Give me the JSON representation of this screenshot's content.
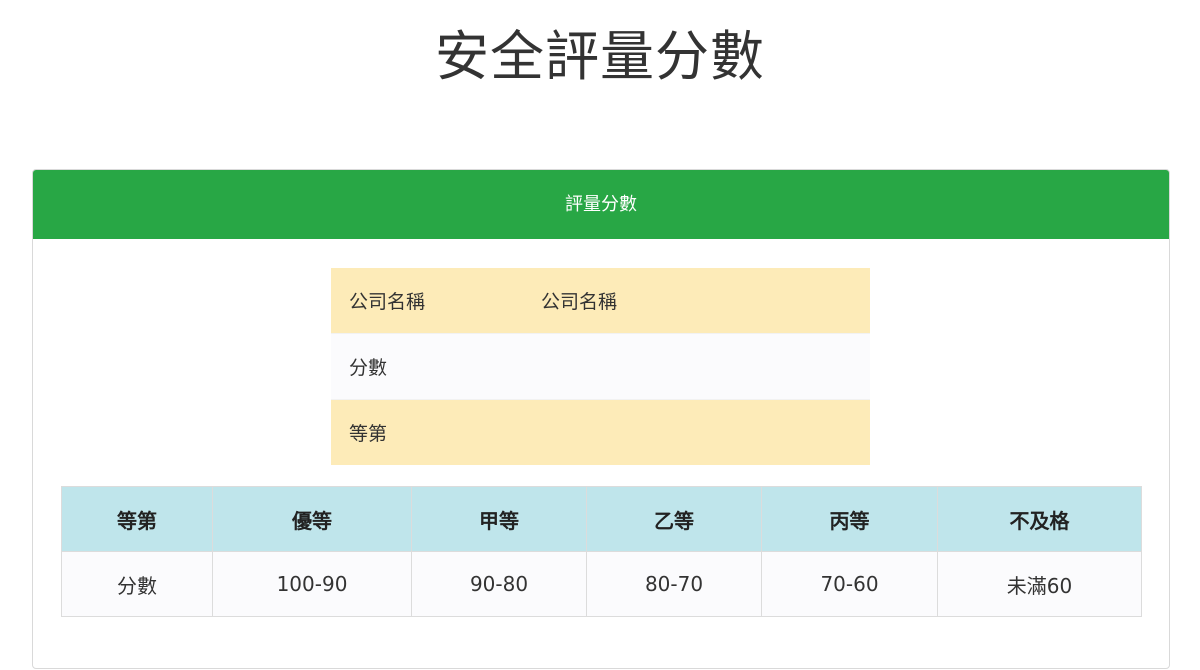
{
  "page_title": "安全評量分數",
  "panel": {
    "heading": "評量分數"
  },
  "info_rows": [
    {
      "label": "公司名稱",
      "value": "公司名稱"
    },
    {
      "label": "分數",
      "value": ""
    },
    {
      "label": "等第",
      "value": ""
    }
  ],
  "grade_table": {
    "headers": [
      "等第",
      "優等",
      "甲等",
      "乙等",
      "丙等",
      "不及格"
    ],
    "row": [
      "分數",
      "100-90",
      "90-80",
      "80-70",
      "70-60",
      "未滿60"
    ]
  },
  "colors": {
    "panel_heading_bg": "#28a745",
    "info_row_highlight": "#fdebb8",
    "grade_header_bg": "#bfe5eb"
  }
}
